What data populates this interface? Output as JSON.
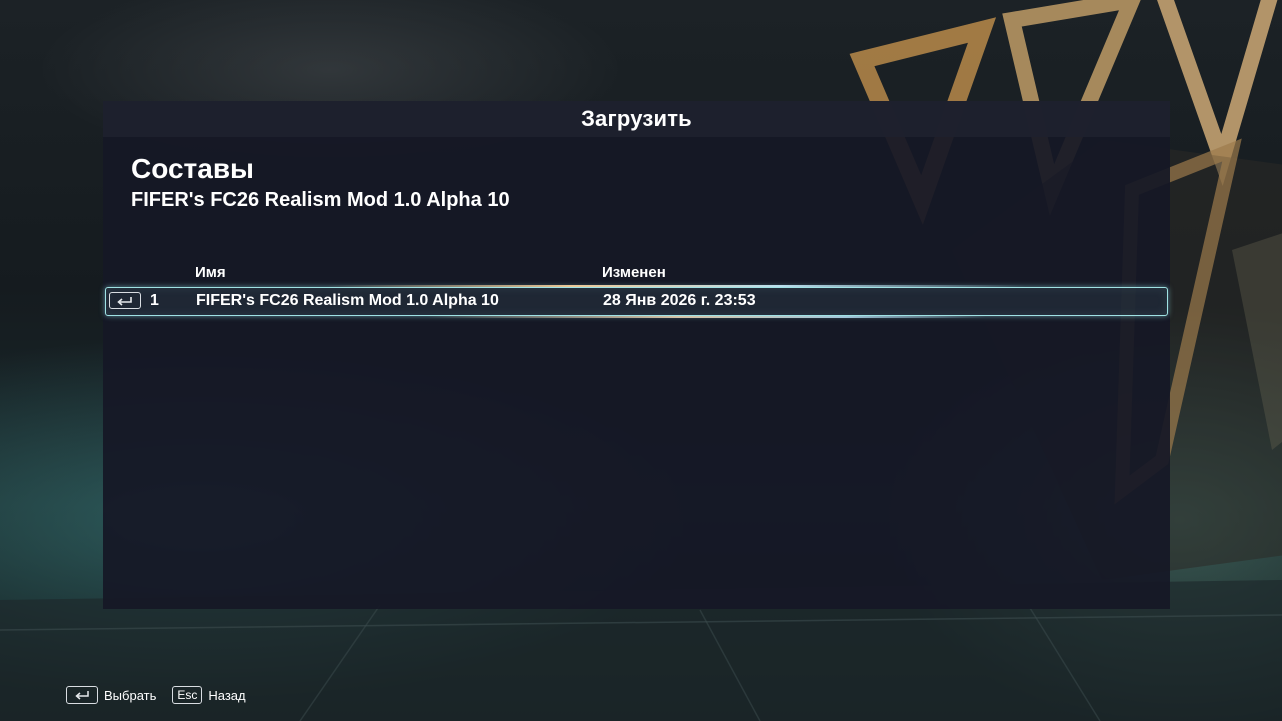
{
  "modal": {
    "title": "Загрузить",
    "section_title": "Составы",
    "section_subtitle": "FIFER's FC26 Realism Mod 1.0 Alpha 10"
  },
  "table": {
    "columns": [
      "Имя",
      "Изменен"
    ],
    "rows": [
      {
        "index": "1",
        "name": "FIFER's FC26 Realism Mod 1.0 Alpha 10",
        "modified": "28 Янв 2026 г. 23:53",
        "key_icon": "enter-key-icon"
      }
    ]
  },
  "footer": {
    "select": {
      "key_icon": "enter-key-icon",
      "label": "Выбрать"
    },
    "back": {
      "key": "Esc",
      "label": "Назад"
    }
  },
  "colors": {
    "accent": "#9fe2e4",
    "panel": "#161826",
    "text": "#ffffff"
  }
}
